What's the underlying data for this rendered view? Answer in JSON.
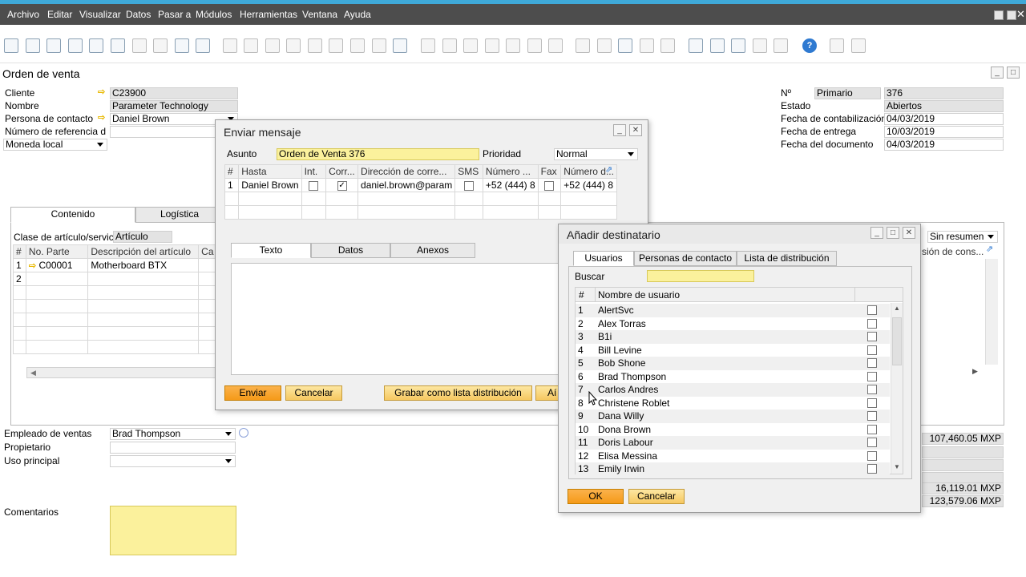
{
  "menu": [
    "Archivo",
    "Editar",
    "Visualizar",
    "Datos",
    "Pasar a",
    "Módulos",
    "Herramientas",
    "Ventana",
    "Ayuda"
  ],
  "form": {
    "title": "Orden de venta",
    "labels": {
      "cliente": "Cliente",
      "nombre": "Nombre",
      "contacto": "Persona de contacto",
      "referencia": "Número de referencia d",
      "moneda": "Moneda local",
      "numero": "Nº",
      "estado": "Estado",
      "fecha_contab": "Fecha de contabilización",
      "fecha_entrega": "Fecha de entrega",
      "fecha_doc": "Fecha del documento",
      "empleado": "Empleado de ventas",
      "propietario": "Propietario",
      "uso": "Uso principal",
      "comentarios": "Comentarios",
      "clase": "Clase de artículo/servicio"
    },
    "values": {
      "cliente": "C23900",
      "nombre": "Parameter Technology",
      "contacto": "Daniel Brown",
      "referencia": "",
      "serie": "Primario",
      "numero": "376",
      "estado": "Abiertos",
      "fecha_contab": "04/03/2019",
      "fecha_entrega": "10/03/2019",
      "fecha_doc": "04/03/2019",
      "empleado": "Brad Thompson",
      "propietario": "",
      "uso": "",
      "clase": "Artículo",
      "resumen": "Sin resumen",
      "total_antes": "107,460.05 MXP",
      "impuesto": "16,119.01 MXP",
      "total": "123,579.06 MXP"
    },
    "tabs": [
      "Contenido",
      "Logística"
    ],
    "grid_headers": [
      "#",
      "No. Parte",
      "Descripción del artículo",
      "Ca"
    ],
    "grid_rows": [
      {
        "n": "1",
        "parte": "C00001",
        "desc": "Motherboard BTX"
      },
      {
        "n": "2",
        "parte": "",
        "desc": ""
      }
    ],
    "right_col_header": "sión de cons..."
  },
  "mensaje": {
    "title": "Enviar mensaje",
    "asunto_label": "Asunto",
    "asunto": "Orden de Venta 376",
    "prioridad_label": "Prioridad",
    "prioridad": "Normal",
    "headers": [
      "#",
      "Hasta",
      "Int.",
      "Corr...",
      "Dirección de corre...",
      "SMS",
      "Número ...",
      "Fax",
      "Número d..."
    ],
    "row": {
      "n": "1",
      "hasta": "Daniel Brown",
      "email": "daniel.brown@param",
      "num1": "+52 (444) 8",
      "num2": "+52 (444) 8"
    },
    "tabs": [
      "Texto",
      "Datos",
      "Anexos"
    ],
    "btn_enviar": "Enviar",
    "btn_cancelar": "Cancelar",
    "btn_grabar": "Grabar como lista distribución",
    "btn_cut": "Aí"
  },
  "destinatario": {
    "title": "Añadir destinatario",
    "tabs": [
      "Usuarios",
      "Personas de contacto",
      "Lista de distribución"
    ],
    "buscar_label": "Buscar",
    "buscar_value": "",
    "col_num": "#",
    "col_name": "Nombre de usuario",
    "users": [
      {
        "n": "1",
        "name": "AlertSvc"
      },
      {
        "n": "2",
        "name": "Alex Torras"
      },
      {
        "n": "3",
        "name": "B1i"
      },
      {
        "n": "4",
        "name": "Bill Levine"
      },
      {
        "n": "5",
        "name": "Bob Shone"
      },
      {
        "n": "6",
        "name": "Brad Thompson"
      },
      {
        "n": "7",
        "name": "Carlos Andres"
      },
      {
        "n": "8",
        "name": "Christene Roblet"
      },
      {
        "n": "9",
        "name": "Dana Willy"
      },
      {
        "n": "10",
        "name": "Dona Brown"
      },
      {
        "n": "11",
        "name": "Doris Labour"
      },
      {
        "n": "12",
        "name": "Elisa Messina"
      },
      {
        "n": "13",
        "name": "Emily Irwin"
      }
    ],
    "btn_ok": "OK",
    "btn_cancelar": "Cancelar"
  }
}
